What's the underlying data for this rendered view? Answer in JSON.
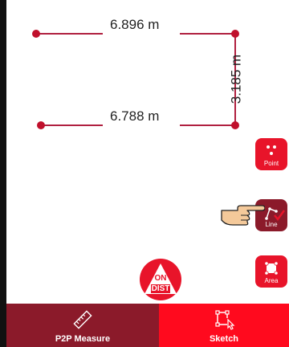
{
  "measurements": {
    "top": "6.896 m",
    "right": "3.185 m",
    "bottom": "6.788 m"
  },
  "tools": {
    "point_label": "Point",
    "line_label": "Line",
    "area_label": "Area"
  },
  "on_dist": {
    "line1": "ON",
    "line2": "DIST"
  },
  "tabs": {
    "p2p_label": "P2P Measure",
    "sketch_label": "Sketch"
  },
  "colors": {
    "accent": "#e8142a",
    "accent_dark": "#8b1a2a",
    "line": "#b02040"
  },
  "icons": {
    "point": "point-icon",
    "line": "line-icon",
    "area": "area-icon",
    "ruler": "ruler-icon",
    "sketch": "sketch-icon",
    "hand": "pointing-hand-icon"
  }
}
